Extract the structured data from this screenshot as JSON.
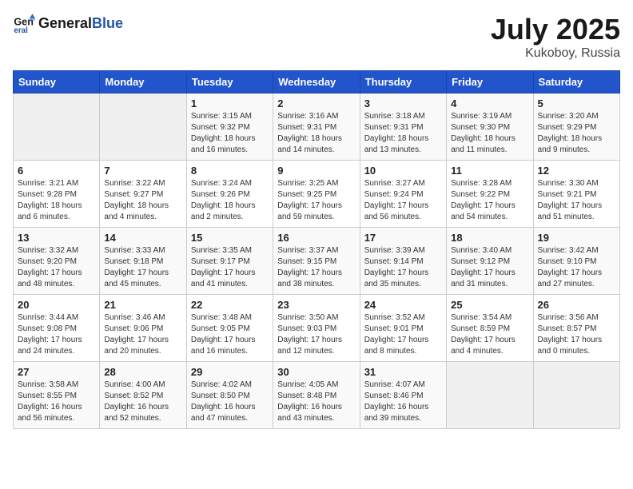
{
  "header": {
    "logo_line1": "General",
    "logo_line2": "Blue",
    "title": "July 2025",
    "subtitle": "Kukoboy, Russia"
  },
  "weekdays": [
    "Sunday",
    "Monday",
    "Tuesday",
    "Wednesday",
    "Thursday",
    "Friday",
    "Saturday"
  ],
  "weeks": [
    [
      {
        "day": "",
        "sunrise": "",
        "sunset": "",
        "daylight": "",
        "empty": true
      },
      {
        "day": "",
        "sunrise": "",
        "sunset": "",
        "daylight": "",
        "empty": true
      },
      {
        "day": "1",
        "sunrise": "Sunrise: 3:15 AM",
        "sunset": "Sunset: 9:32 PM",
        "daylight": "Daylight: 18 hours and 16 minutes."
      },
      {
        "day": "2",
        "sunrise": "Sunrise: 3:16 AM",
        "sunset": "Sunset: 9:31 PM",
        "daylight": "Daylight: 18 hours and 14 minutes."
      },
      {
        "day": "3",
        "sunrise": "Sunrise: 3:18 AM",
        "sunset": "Sunset: 9:31 PM",
        "daylight": "Daylight: 18 hours and 13 minutes."
      },
      {
        "day": "4",
        "sunrise": "Sunrise: 3:19 AM",
        "sunset": "Sunset: 9:30 PM",
        "daylight": "Daylight: 18 hours and 11 minutes."
      },
      {
        "day": "5",
        "sunrise": "Sunrise: 3:20 AM",
        "sunset": "Sunset: 9:29 PM",
        "daylight": "Daylight: 18 hours and 9 minutes."
      }
    ],
    [
      {
        "day": "6",
        "sunrise": "Sunrise: 3:21 AM",
        "sunset": "Sunset: 9:28 PM",
        "daylight": "Daylight: 18 hours and 6 minutes."
      },
      {
        "day": "7",
        "sunrise": "Sunrise: 3:22 AM",
        "sunset": "Sunset: 9:27 PM",
        "daylight": "Daylight: 18 hours and 4 minutes."
      },
      {
        "day": "8",
        "sunrise": "Sunrise: 3:24 AM",
        "sunset": "Sunset: 9:26 PM",
        "daylight": "Daylight: 18 hours and 2 minutes."
      },
      {
        "day": "9",
        "sunrise": "Sunrise: 3:25 AM",
        "sunset": "Sunset: 9:25 PM",
        "daylight": "Daylight: 17 hours and 59 minutes."
      },
      {
        "day": "10",
        "sunrise": "Sunrise: 3:27 AM",
        "sunset": "Sunset: 9:24 PM",
        "daylight": "Daylight: 17 hours and 56 minutes."
      },
      {
        "day": "11",
        "sunrise": "Sunrise: 3:28 AM",
        "sunset": "Sunset: 9:22 PM",
        "daylight": "Daylight: 17 hours and 54 minutes."
      },
      {
        "day": "12",
        "sunrise": "Sunrise: 3:30 AM",
        "sunset": "Sunset: 9:21 PM",
        "daylight": "Daylight: 17 hours and 51 minutes."
      }
    ],
    [
      {
        "day": "13",
        "sunrise": "Sunrise: 3:32 AM",
        "sunset": "Sunset: 9:20 PM",
        "daylight": "Daylight: 17 hours and 48 minutes."
      },
      {
        "day": "14",
        "sunrise": "Sunrise: 3:33 AM",
        "sunset": "Sunset: 9:18 PM",
        "daylight": "Daylight: 17 hours and 45 minutes."
      },
      {
        "day": "15",
        "sunrise": "Sunrise: 3:35 AM",
        "sunset": "Sunset: 9:17 PM",
        "daylight": "Daylight: 17 hours and 41 minutes."
      },
      {
        "day": "16",
        "sunrise": "Sunrise: 3:37 AM",
        "sunset": "Sunset: 9:15 PM",
        "daylight": "Daylight: 17 hours and 38 minutes."
      },
      {
        "day": "17",
        "sunrise": "Sunrise: 3:39 AM",
        "sunset": "Sunset: 9:14 PM",
        "daylight": "Daylight: 17 hours and 35 minutes."
      },
      {
        "day": "18",
        "sunrise": "Sunrise: 3:40 AM",
        "sunset": "Sunset: 9:12 PM",
        "daylight": "Daylight: 17 hours and 31 minutes."
      },
      {
        "day": "19",
        "sunrise": "Sunrise: 3:42 AM",
        "sunset": "Sunset: 9:10 PM",
        "daylight": "Daylight: 17 hours and 27 minutes."
      }
    ],
    [
      {
        "day": "20",
        "sunrise": "Sunrise: 3:44 AM",
        "sunset": "Sunset: 9:08 PM",
        "daylight": "Daylight: 17 hours and 24 minutes."
      },
      {
        "day": "21",
        "sunrise": "Sunrise: 3:46 AM",
        "sunset": "Sunset: 9:06 PM",
        "daylight": "Daylight: 17 hours and 20 minutes."
      },
      {
        "day": "22",
        "sunrise": "Sunrise: 3:48 AM",
        "sunset": "Sunset: 9:05 PM",
        "daylight": "Daylight: 17 hours and 16 minutes."
      },
      {
        "day": "23",
        "sunrise": "Sunrise: 3:50 AM",
        "sunset": "Sunset: 9:03 PM",
        "daylight": "Daylight: 17 hours and 12 minutes."
      },
      {
        "day": "24",
        "sunrise": "Sunrise: 3:52 AM",
        "sunset": "Sunset: 9:01 PM",
        "daylight": "Daylight: 17 hours and 8 minutes."
      },
      {
        "day": "25",
        "sunrise": "Sunrise: 3:54 AM",
        "sunset": "Sunset: 8:59 PM",
        "daylight": "Daylight: 17 hours and 4 minutes."
      },
      {
        "day": "26",
        "sunrise": "Sunrise: 3:56 AM",
        "sunset": "Sunset: 8:57 PM",
        "daylight": "Daylight: 17 hours and 0 minutes."
      }
    ],
    [
      {
        "day": "27",
        "sunrise": "Sunrise: 3:58 AM",
        "sunset": "Sunset: 8:55 PM",
        "daylight": "Daylight: 16 hours and 56 minutes."
      },
      {
        "day": "28",
        "sunrise": "Sunrise: 4:00 AM",
        "sunset": "Sunset: 8:52 PM",
        "daylight": "Daylight: 16 hours and 52 minutes."
      },
      {
        "day": "29",
        "sunrise": "Sunrise: 4:02 AM",
        "sunset": "Sunset: 8:50 PM",
        "daylight": "Daylight: 16 hours and 47 minutes."
      },
      {
        "day": "30",
        "sunrise": "Sunrise: 4:05 AM",
        "sunset": "Sunset: 8:48 PM",
        "daylight": "Daylight: 16 hours and 43 minutes."
      },
      {
        "day": "31",
        "sunrise": "Sunrise: 4:07 AM",
        "sunset": "Sunset: 8:46 PM",
        "daylight": "Daylight: 16 hours and 39 minutes."
      },
      {
        "day": "",
        "sunrise": "",
        "sunset": "",
        "daylight": "",
        "empty": true
      },
      {
        "day": "",
        "sunrise": "",
        "sunset": "",
        "daylight": "",
        "empty": true
      }
    ]
  ]
}
